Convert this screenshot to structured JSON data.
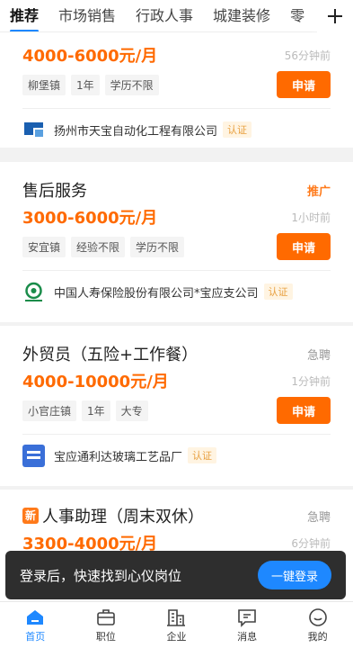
{
  "tabs": [
    "推荐",
    "市场销售",
    "行政人事",
    "城建装修",
    "零"
  ],
  "cards": [
    {
      "salary": "4000-6000元/月",
      "time": "56分钟前",
      "chips": [
        "柳堡镇",
        "1年",
        "学历不限"
      ],
      "apply": "申请",
      "company": "扬州市天宝自动化工程有限公司",
      "verified": "认证"
    },
    {
      "title": "售后服务",
      "tag": "推广",
      "salary": "3000-6000元/月",
      "time": "1小时前",
      "chips": [
        "安宜镇",
        "经验不限",
        "学历不限"
      ],
      "apply": "申请",
      "company": "中国人寿保险股份有限公司*宝应支公司",
      "verified": "认证"
    },
    {
      "title": "外贸员（五险+工作餐）",
      "tag": "急聘",
      "salary": "4000-10000元/月",
      "time": "1分钟前",
      "chips": [
        "小官庄镇",
        "1年",
        "大专"
      ],
      "apply": "申请",
      "company": "宝应通利达玻璃工艺品厂",
      "verified": "认证"
    },
    {
      "badge": "新",
      "title": "人事助理（周末双休）",
      "tag": "急聘",
      "salary": "3300-4000元/月",
      "time": "6分钟前"
    }
  ],
  "login_banner": {
    "text": "登录后，快速找到心仪岗位",
    "button": "一键登录"
  },
  "nav": [
    "首页",
    "职位",
    "企业",
    "消息",
    "我的"
  ],
  "colors": {
    "accent": "#1e88ff",
    "salary": "#ff6a00"
  }
}
